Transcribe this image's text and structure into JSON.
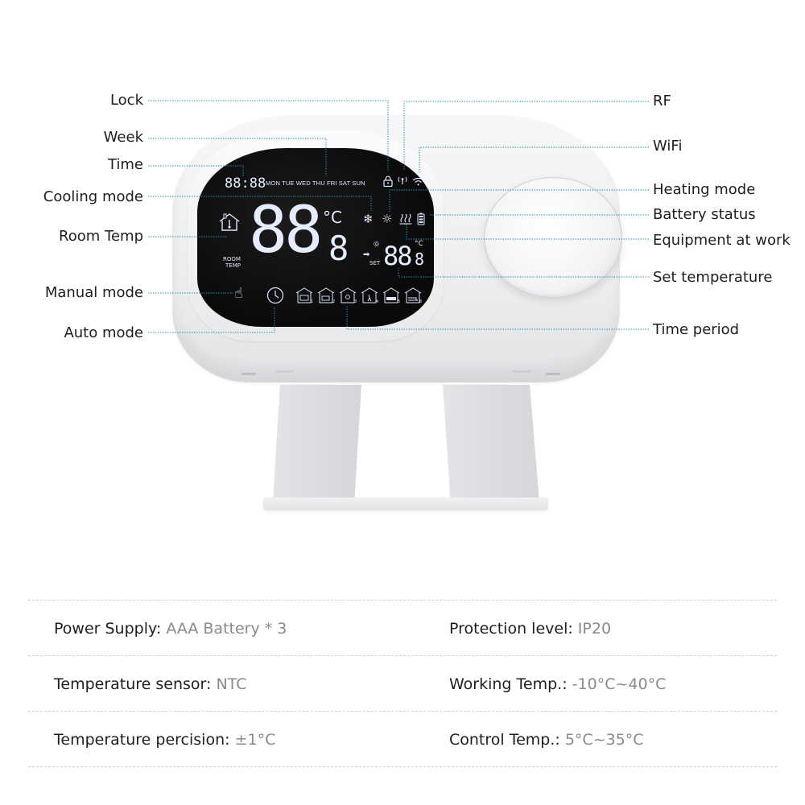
{
  "callouts": {
    "left": [
      {
        "id": "lock",
        "label": "Lock"
      },
      {
        "id": "week",
        "label": "Week"
      },
      {
        "id": "time",
        "label": "Time"
      },
      {
        "id": "cooling",
        "label": "Cooling mode"
      },
      {
        "id": "room-temp",
        "label": "Room Temp"
      },
      {
        "id": "manual",
        "label": "Manual mode"
      },
      {
        "id": "auto",
        "label": "Auto mode"
      }
    ],
    "right": [
      {
        "id": "rf",
        "label": "RF"
      },
      {
        "id": "wifi",
        "label": "WiFi"
      },
      {
        "id": "heating",
        "label": "Heating mode"
      },
      {
        "id": "battery",
        "label": "Battery status"
      },
      {
        "id": "equipment",
        "label": "Equipment at work"
      },
      {
        "id": "set-temp",
        "label": "Set temperature"
      },
      {
        "id": "time-period",
        "label": "Time period"
      }
    ]
  },
  "lcd": {
    "clock": "88:88",
    "days": "MON TUE WED THU FRI SAT SUN",
    "room_temp_digits": "88",
    "room_temp_decimal": "8",
    "room_temp_unit": "°C",
    "room_label_1": "ROOM",
    "room_label_2": "TEMP",
    "set_label": "SET",
    "set_temp_digits": "88",
    "set_temp_decimal": "8",
    "set_temp_unit": "°C",
    "period_numbers": [
      "1",
      "2",
      "3",
      "4",
      "5",
      "6"
    ]
  },
  "specs": [
    {
      "key": "Power Supply:",
      "value": "AAA Battery * 3"
    },
    {
      "key": "Protection level:",
      "value": "IP20"
    },
    {
      "key": "Temperature sensor:",
      "value": "NTC"
    },
    {
      "key": "Working Temp.:",
      "value": "-10°C~40°C"
    },
    {
      "key": "Temperature percision:",
      "value": "±1°C"
    },
    {
      "key": "Control Temp.:",
      "value": "5°C~35°C"
    }
  ],
  "colors": {
    "leader_line": "#2a8fb0",
    "lcd_background": "#0d0d0e",
    "lcd_segment": "#e6ecff",
    "spec_value": "#8a8a8a"
  }
}
